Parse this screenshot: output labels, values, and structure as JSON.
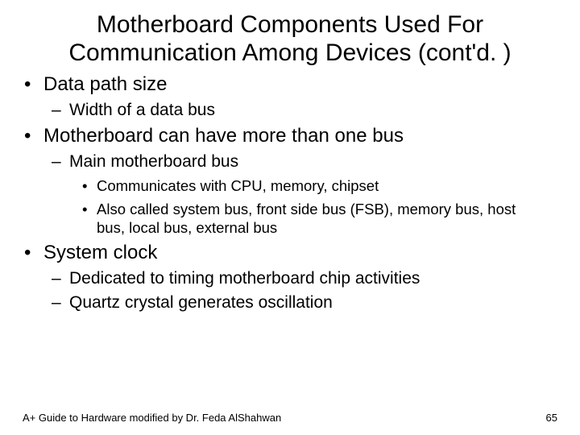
{
  "title": "Motherboard Components Used For Communication Among Devices (cont'd. )",
  "bullets": {
    "i0": "Data path size",
    "i0_0": "Width of a data bus",
    "i1": "Motherboard can have more than one bus",
    "i1_0": "Main motherboard bus",
    "i1_0_0": "Communicates with CPU, memory, chipset",
    "i1_0_1": "Also called system bus, front side bus (FSB), memory bus, host bus, local bus, external bus",
    "i2": "System clock",
    "i2_0": "Dedicated to timing motherboard chip activities",
    "i2_1": "Quartz crystal generates oscillation"
  },
  "footer": {
    "left": "A+ Guide to Hardware modified by Dr. Feda AlShahwan",
    "page": "65"
  }
}
